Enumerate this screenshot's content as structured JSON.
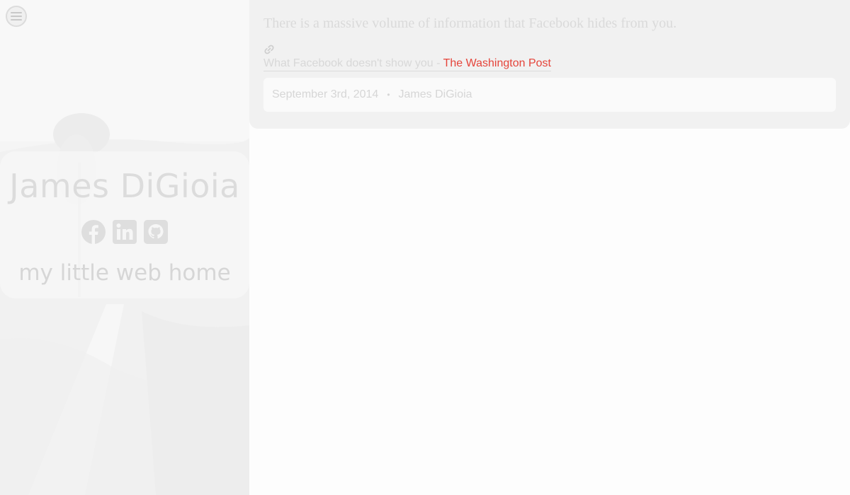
{
  "header": {
    "menu_icon": "hamburger-menu-icon"
  },
  "profile": {
    "name": "James DiGioia",
    "tagline": "my little web home",
    "social": [
      {
        "icon": "facebook-icon"
      },
      {
        "icon": "linkedin-icon"
      },
      {
        "icon": "github-icon"
      }
    ]
  },
  "post": {
    "excerpt": "There is a massive volume of information that Facebook hides from you.",
    "link_icon": "link-icon",
    "link_title": "What Facebook doesn't show you",
    "link_separator": " - ",
    "link_source": "The Washington Post",
    "date": "September 3rd, 2014",
    "separator": "•",
    "author": "James DiGioia"
  },
  "colors": {
    "page_bg": "#fdfdfd",
    "sidebar_bg": "#f4f4f4",
    "card_bg": "#f1f1f1",
    "meta_bg": "#fafafa",
    "faded_text": "#d8d8d8",
    "source_accent": "#e5443a"
  }
}
